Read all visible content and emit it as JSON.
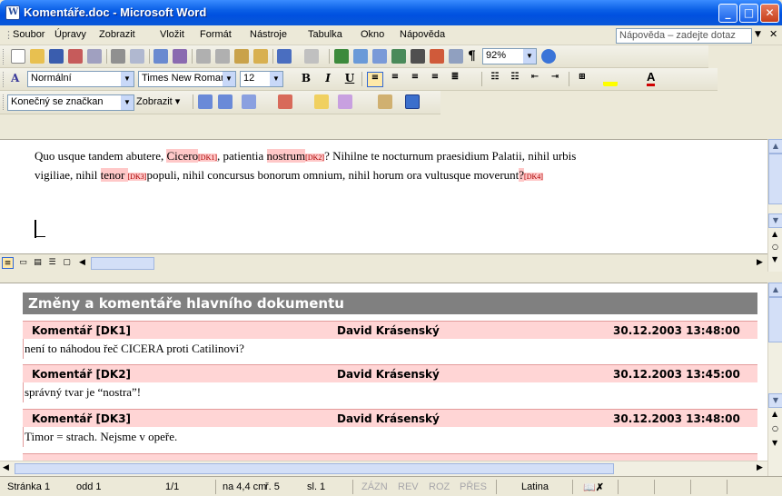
{
  "window": {
    "title": "Komentáře.doc - Microsoft Word"
  },
  "menu": {
    "items": [
      "Soubor",
      "Úpravy",
      "Zobrazit",
      "Vložit",
      "Formát",
      "Nástroje",
      "Tabulka",
      "Okno",
      "Nápověda"
    ],
    "help_placeholder": "Nápověda – zadejte dotaz"
  },
  "toolbar_standard": {
    "zoom": "92%"
  },
  "toolbar_format": {
    "style": "Normální",
    "font": "Times New Roman",
    "size": "12"
  },
  "toolbar_review": {
    "display": "Konečný se značkan",
    "show": "Zobrazit"
  },
  "document": {
    "segments": [
      "Quo usque tandem abutere, ",
      "Cicero",
      "[DK1]",
      ", patientia ",
      "nostrum",
      "[DK2]",
      "? Nihilne te nocturnum praesidium Palatii, nihil urbis vigiliae, nihil ",
      "tenor ",
      "[DK3]",
      "populi, nihil concursus bonorum omnium, nihil horum ora vultusque moverunt",
      "?",
      "[DK4]"
    ]
  },
  "review": {
    "header": "Změny a komentáře hlavního dokumentu",
    "comments": [
      {
        "label": "Komentář [DK1]",
        "author": "David Krásenský",
        "date": "30.12.2003 13:48:00",
        "text": "není to náhodou řeč CICERA proti Catilinovi?"
      },
      {
        "label": "Komentář [DK2]",
        "author": "David Krásenský",
        "date": "30.12.2003 13:45:00",
        "text": "správný tvar je “nostra”!"
      },
      {
        "label": "Komentář [DK3]",
        "author": "David Krásenský",
        "date": "30.12.2003 13:48:00",
        "text": "Timor = strach. Nejsme v opeře."
      }
    ]
  },
  "status": {
    "page": "Stránka 1",
    "section": "odd 1",
    "pages": "1/1",
    "at": "na 4,4 cm",
    "line": "ř. 5",
    "col": "sl. 1",
    "rec": "ZÁZN",
    "trk": "REV",
    "ext": "ROZ",
    "ovr": "PŘES",
    "lang": "Latina"
  },
  "colors": {
    "titlebar": "#0a5fe6",
    "comment_bg": "#ffd5d5",
    "review_header": "#808080"
  }
}
